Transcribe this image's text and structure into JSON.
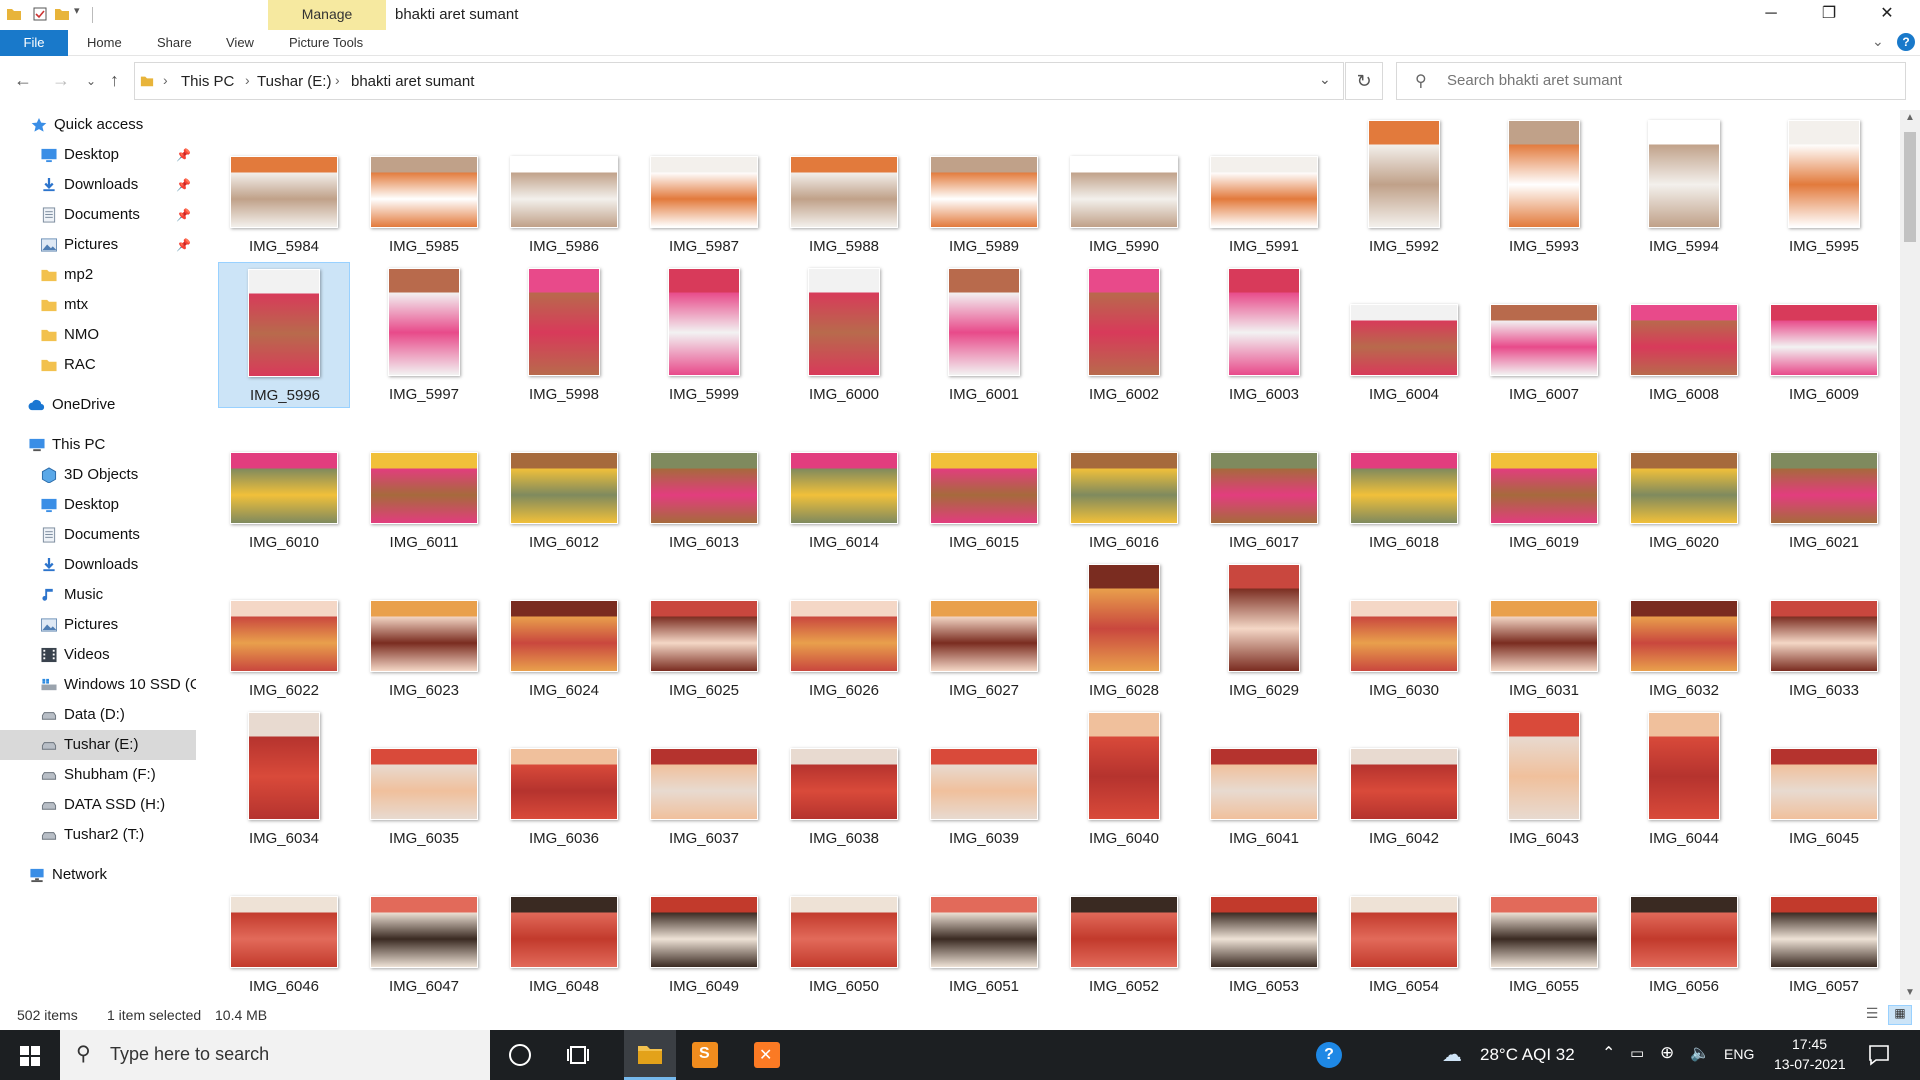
{
  "window": {
    "title": "bhakti aret sumant",
    "manage_tab": "Manage",
    "minimize": "─",
    "maximize": "❐",
    "close": "✕"
  },
  "ribbon": {
    "file": "File",
    "tabs": [
      "Home",
      "Share",
      "View",
      "Picture Tools"
    ]
  },
  "address": {
    "crumbs": [
      "This PC",
      "Tushar (E:)",
      "bhakti aret sumant"
    ]
  },
  "search": {
    "placeholder": "Search bhakti aret sumant"
  },
  "sidebar": {
    "items": [
      {
        "label": "Quick access",
        "icon": "star-icon",
        "pinned": false
      },
      {
        "label": "Desktop",
        "icon": "desktop-icon",
        "pinned": true
      },
      {
        "label": "Downloads",
        "icon": "download-icon",
        "pinned": true
      },
      {
        "label": "Documents",
        "icon": "document-icon",
        "pinned": true
      },
      {
        "label": "Pictures",
        "icon": "pictures-icon",
        "pinned": true
      },
      {
        "label": "mp2",
        "icon": "folder-icon",
        "pinned": false
      },
      {
        "label": "mtx",
        "icon": "folder-icon",
        "pinned": false
      },
      {
        "label": "NMO",
        "icon": "folder-icon",
        "pinned": false
      },
      {
        "label": "RAC",
        "icon": "folder-icon",
        "pinned": false
      },
      {
        "label": "OneDrive",
        "icon": "cloud-icon",
        "pinned": false
      },
      {
        "label": "This PC",
        "icon": "pc-icon",
        "pinned": false
      },
      {
        "label": "3D Objects",
        "icon": "cube-icon",
        "pinned": false
      },
      {
        "label": "Desktop",
        "icon": "desktop-icon",
        "pinned": false
      },
      {
        "label": "Documents",
        "icon": "document-icon",
        "pinned": false
      },
      {
        "label": "Downloads",
        "icon": "download-icon",
        "pinned": false
      },
      {
        "label": "Music",
        "icon": "music-icon",
        "pinned": false
      },
      {
        "label": "Pictures",
        "icon": "pictures-icon",
        "pinned": false
      },
      {
        "label": "Videos",
        "icon": "video-icon",
        "pinned": false
      },
      {
        "label": "Windows 10 SSD (C",
        "icon": "windows-drive-icon",
        "pinned": false
      },
      {
        "label": "Data (D:)",
        "icon": "drive-icon",
        "pinned": false
      },
      {
        "label": "Tushar (E:)",
        "icon": "drive-icon",
        "pinned": false,
        "selected": true
      },
      {
        "label": "Shubham (F:)",
        "icon": "drive-icon",
        "pinned": false
      },
      {
        "label": "DATA SSD (H:)",
        "icon": "drive-icon",
        "pinned": false
      },
      {
        "label": "Tushar2 (T:)",
        "icon": "drive-icon",
        "pinned": false
      },
      {
        "label": "Network",
        "icon": "network-icon",
        "pinned": false
      }
    ]
  },
  "files": [
    [
      "IMG_5984",
      "IMG_5985",
      "IMG_5986",
      "IMG_5987",
      "IMG_5988",
      "IMG_5989",
      "IMG_5990",
      "IMG_5991",
      "IMG_5992",
      "IMG_5993",
      "IMG_5994",
      "IMG_5995"
    ],
    [
      "IMG_5996",
      "IMG_5997",
      "IMG_5998",
      "IMG_5999",
      "IMG_6000",
      "IMG_6001",
      "IMG_6002",
      "IMG_6003",
      "IMG_6004",
      "IMG_6007",
      "IMG_6008",
      "IMG_6009"
    ],
    [
      "IMG_6010",
      "IMG_6011",
      "IMG_6012",
      "IMG_6013",
      "IMG_6014",
      "IMG_6015",
      "IMG_6016",
      "IMG_6017",
      "IMG_6018",
      "IMG_6019",
      "IMG_6020",
      "IMG_6021"
    ],
    [
      "IMG_6022",
      "IMG_6023",
      "IMG_6024",
      "IMG_6025",
      "IMG_6026",
      "IMG_6027",
      "IMG_6028",
      "IMG_6029",
      "IMG_6030",
      "IMG_6031",
      "IMG_6032",
      "IMG_6033"
    ],
    [
      "IMG_6034",
      "IMG_6035",
      "IMG_6036",
      "IMG_6037",
      "IMG_6038",
      "IMG_6039",
      "IMG_6040",
      "IMG_6041",
      "IMG_6042",
      "IMG_6043",
      "IMG_6044",
      "IMG_6045"
    ],
    [
      "IMG_6046",
      "IMG_6047",
      "IMG_6048",
      "IMG_6049",
      "IMG_6050",
      "IMG_6051",
      "IMG_6052",
      "IMG_6053",
      "IMG_6054",
      "IMG_6055",
      "IMG_6056",
      "IMG_6057"
    ]
  ],
  "selected_file": "IMG_5996",
  "status": {
    "items": "502 items",
    "selection": "1 item selected",
    "size": "10.4 MB"
  },
  "taskbar": {
    "search_placeholder": "Type here to search",
    "weather": "28°C AQI 32",
    "language": "ENG",
    "time": "17:45",
    "date": "13-07-2021"
  },
  "colors": {
    "accent": "#1979ca",
    "manage": "#f6e9a0",
    "selection": "#cce4f7",
    "taskbar": "#1c1f22"
  }
}
